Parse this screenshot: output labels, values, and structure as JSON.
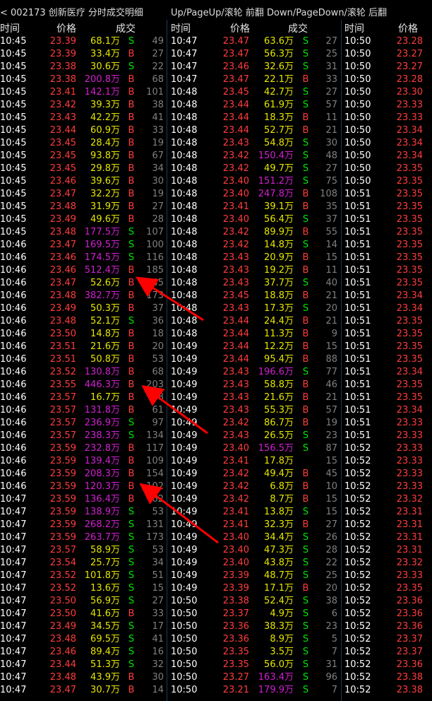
{
  "header": {
    "title": "< 002173 创新医疗   分时成交明细",
    "hint": "Up/PageUp/滚轮 前翻 Down/PageDown/滚轮 后翻"
  },
  "column_headers": {
    "time": "时间",
    "price": "价格",
    "deal": "成交"
  },
  "colors": {
    "up": "#ff3c3c",
    "down": "#00e600",
    "vol_normal": "#e6e600",
    "vol_big": "#d21ed2",
    "neutral": "#808080",
    "arrow": "#ff0000"
  },
  "columns": [
    {
      "rows": [
        [
          "10:45",
          "23.39",
          "68.1万",
          "S",
          "49",
          "r",
          "y"
        ],
        [
          "10:45",
          "23.39",
          "33.4万",
          "B",
          "27",
          "r",
          "y"
        ],
        [
          "10:45",
          "23.38",
          "30.6万",
          "S",
          "22",
          "r",
          "y"
        ],
        [
          "10:45",
          "23.38",
          "200.8万",
          "B",
          "68",
          "r",
          "m"
        ],
        [
          "10:45",
          "23.41",
          "142.1万",
          "B",
          "101",
          "r",
          "m"
        ],
        [
          "10:45",
          "23.42",
          "39.3万",
          "B",
          "38",
          "r",
          "y"
        ],
        [
          "10:45",
          "23.43",
          "42.2万",
          "B",
          "41",
          "r",
          "y"
        ],
        [
          "10:45",
          "23.44",
          "60.9万",
          "B",
          "33",
          "r",
          "y"
        ],
        [
          "10:45",
          "23.45",
          "28.4万",
          "B",
          "19",
          "r",
          "y"
        ],
        [
          "10:45",
          "23.45",
          "93.8万",
          "B",
          "67",
          "r",
          "y"
        ],
        [
          "10:45",
          "23.45",
          "29.8万",
          "B",
          "34",
          "r",
          "y"
        ],
        [
          "10:45",
          "23.46",
          "39.6万",
          "B",
          "30",
          "r",
          "y"
        ],
        [
          "10:45",
          "23.47",
          "32.2万",
          "B",
          "19",
          "r",
          "y"
        ],
        [
          "10:45",
          "23.48",
          "31.9万",
          "B",
          "27",
          "r",
          "y"
        ],
        [
          "10:45",
          "23.49",
          "49.6万",
          "B",
          "28",
          "r",
          "y"
        ],
        [
          "10:45",
          "23.48",
          "177.5万",
          "S",
          "107",
          "r",
          "m"
        ],
        [
          "10:46",
          "23.47",
          "169.5万",
          "S",
          "100",
          "r",
          "m"
        ],
        [
          "10:46",
          "23.46",
          "174.5万",
          "S",
          "116",
          "r",
          "m"
        ],
        [
          "10:46",
          "23.46",
          "512.4万",
          "B",
          "185",
          "r",
          "m"
        ],
        [
          "10:46",
          "23.47",
          "52.6万",
          "B",
          "45",
          "r",
          "y"
        ],
        [
          "10:46",
          "23.48",
          "382.7万",
          "B",
          "173",
          "r",
          "m"
        ],
        [
          "10:46",
          "23.49",
          "50.3万",
          "B",
          "37",
          "r",
          "y"
        ],
        [
          "10:46",
          "23.48",
          "52.1万",
          "S",
          "36",
          "r",
          "y"
        ],
        [
          "10:46",
          "23.50",
          "14.8万",
          "B",
          "18",
          "r",
          "y"
        ],
        [
          "10:46",
          "23.51",
          "21.6万",
          "B",
          "20",
          "r",
          "y"
        ],
        [
          "10:46",
          "23.51",
          "50.8万",
          "B",
          "53",
          "r",
          "y"
        ],
        [
          "10:46",
          "23.52",
          "130.8万",
          "B",
          "68",
          "r",
          "m"
        ],
        [
          "10:46",
          "23.55",
          "446.3万",
          "B",
          "203",
          "r",
          "m"
        ],
        [
          "10:46",
          "23.57",
          "16.7万",
          "B",
          "28",
          "r",
          "y"
        ],
        [
          "10:46",
          "23.57",
          "131.8万",
          "B",
          "61",
          "r",
          "m"
        ],
        [
          "10:46",
          "23.57",
          "236.9万",
          "S",
          "97",
          "r",
          "m"
        ],
        [
          "10:46",
          "23.57",
          "238.3万",
          "S",
          "134",
          "r",
          "m"
        ],
        [
          "10:46",
          "23.59",
          "232.8万",
          "B",
          "117",
          "r",
          "m"
        ],
        [
          "10:46",
          "23.59",
          "139.4万",
          "B",
          "109",
          "r",
          "m"
        ],
        [
          "10:46",
          "23.59",
          "208.3万",
          "B",
          "154",
          "r",
          "m"
        ],
        [
          "10:46",
          "23.59",
          "120.3万",
          "B",
          "102",
          "r",
          "m"
        ],
        [
          "10:47",
          "23.59",
          "136.4万",
          "B",
          "62",
          "r",
          "m"
        ],
        [
          "10:47",
          "23.59",
          "138.9万",
          "S",
          "53",
          "r",
          "m"
        ],
        [
          "10:47",
          "23.59",
          "268.2万",
          "S",
          "131",
          "r",
          "m"
        ],
        [
          "10:47",
          "23.59",
          "263.7万",
          "S",
          "173",
          "r",
          "m"
        ],
        [
          "10:47",
          "23.57",
          "58.9万",
          "S",
          "53",
          "r",
          "y"
        ],
        [
          "10:47",
          "23.54",
          "25.7万",
          "S",
          "34",
          "r",
          "y"
        ],
        [
          "10:47",
          "23.52",
          "101.8万",
          "S",
          "51",
          "r",
          "y"
        ],
        [
          "10:47",
          "23.52",
          "13.6万",
          "S",
          "15",
          "r",
          "y"
        ],
        [
          "10:47",
          "23.50",
          "56.9万",
          "S",
          "27",
          "r",
          "y"
        ],
        [
          "10:47",
          "23.50",
          "41.6万",
          "B",
          "33",
          "r",
          "y"
        ],
        [
          "10:47",
          "23.49",
          "34.5万",
          "S",
          "17",
          "r",
          "y"
        ],
        [
          "10:47",
          "23.48",
          "69.5万",
          "S",
          "41",
          "r",
          "y"
        ],
        [
          "10:47",
          "23.46",
          "89.4万",
          "S",
          "16",
          "r",
          "y"
        ],
        [
          "10:47",
          "23.44",
          "51.3万",
          "S",
          "32",
          "r",
          "y"
        ],
        [
          "10:47",
          "23.48",
          "43.9万",
          "B",
          "30",
          "r",
          "y"
        ],
        [
          "10:47",
          "23.47",
          "30.7万",
          "B",
          "14",
          "r",
          "y"
        ]
      ]
    },
    {
      "rows": [
        [
          "10:47",
          "23.47",
          "63.6万",
          "S",
          "27",
          "r",
          "y"
        ],
        [
          "10:47",
          "23.47",
          "56.3万",
          "S",
          "25",
          "r",
          "y"
        ],
        [
          "10:47",
          "23.46",
          "32.6万",
          "S",
          "31",
          "r",
          "y"
        ],
        [
          "10:47",
          "23.47",
          "22.1万",
          "B",
          "33",
          "r",
          "y"
        ],
        [
          "10:48",
          "23.45",
          "42.7万",
          "S",
          "27",
          "r",
          "y"
        ],
        [
          "10:48",
          "23.44",
          "61.9万",
          "S",
          "57",
          "r",
          "y"
        ],
        [
          "10:48",
          "23.44",
          "18.3万",
          "B",
          "11",
          "r",
          "y"
        ],
        [
          "10:48",
          "23.44",
          "52.7万",
          "B",
          "21",
          "r",
          "y"
        ],
        [
          "10:48",
          "23.43",
          "54.8万",
          "S",
          "30",
          "r",
          "y"
        ],
        [
          "10:48",
          "23.42",
          "150.4万",
          "S",
          "48",
          "r",
          "m"
        ],
        [
          "10:48",
          "23.42",
          "49.7万",
          "S",
          "27",
          "r",
          "y"
        ],
        [
          "10:48",
          "23.40",
          "151.2万",
          "S",
          "75",
          "r",
          "m"
        ],
        [
          "10:48",
          "23.40",
          "247.8万",
          "B",
          "108",
          "r",
          "m"
        ],
        [
          "10:48",
          "23.41",
          "39.1万",
          "B",
          "35",
          "r",
          "y"
        ],
        [
          "10:48",
          "23.40",
          "56.4万",
          "S",
          "37",
          "r",
          "y"
        ],
        [
          "10:48",
          "23.42",
          "89.9万",
          "B",
          "55",
          "r",
          "y"
        ],
        [
          "10:48",
          "23.42",
          "14.8万",
          "S",
          "14",
          "r",
          "y"
        ],
        [
          "10:48",
          "23.43",
          "20.9万",
          "B",
          "15",
          "r",
          "y"
        ],
        [
          "10:48",
          "23.43",
          "19.2万",
          "B",
          "11",
          "r",
          "y"
        ],
        [
          "10:48",
          "23.43",
          "37.7万",
          "S",
          "40",
          "r",
          "y"
        ],
        [
          "10:48",
          "23.45",
          "18.8万",
          "B",
          "21",
          "r",
          "y"
        ],
        [
          "10:48",
          "23.43",
          "17.3万",
          "S",
          "20",
          "r",
          "y"
        ],
        [
          "10:48",
          "23.44",
          "24.4万",
          "B",
          "21",
          "r",
          "y"
        ],
        [
          "10:48",
          "23.44",
          "11.3万",
          "B",
          "9",
          "r",
          "y"
        ],
        [
          "10:49",
          "23.44",
          "12.2万",
          "B",
          "15",
          "r",
          "y"
        ],
        [
          "10:49",
          "23.44",
          "95.4万",
          "B",
          "88",
          "r",
          "y"
        ],
        [
          "10:49",
          "23.43",
          "196.6万",
          "S",
          "77",
          "r",
          "m"
        ],
        [
          "10:49",
          "23.43",
          "58.8万",
          "B",
          "46",
          "r",
          "y"
        ],
        [
          "10:49",
          "23.43",
          "21.6万",
          "B",
          "21",
          "r",
          "y"
        ],
        [
          "10:49",
          "23.43",
          "55.3万",
          "B",
          "57",
          "r",
          "y"
        ],
        [
          "10:49",
          "23.42",
          "86.7万",
          "B",
          "19",
          "r",
          "y"
        ],
        [
          "10:49",
          "23.43",
          "26.5万",
          "S",
          "23",
          "r",
          "y"
        ],
        [
          "10:49",
          "23.40",
          "156.5万",
          "S",
          "87",
          "r",
          "m"
        ],
        [
          "10:49",
          "23.41",
          "17.8万",
          "",
          "15",
          "r",
          "y"
        ],
        [
          "10:49",
          "23.42",
          "49.4万",
          "B",
          "45",
          "r",
          "y"
        ],
        [
          "10:49",
          "23.42",
          "6.8万",
          "B",
          "10",
          "r",
          "y"
        ],
        [
          "10:49",
          "23.42",
          "8.7万",
          "B",
          "15",
          "r",
          "y"
        ],
        [
          "10:49",
          "23.41",
          "13.8万",
          "S",
          "15",
          "r",
          "y"
        ],
        [
          "10:49",
          "23.41",
          "32.3万",
          "B",
          "27",
          "r",
          "y"
        ],
        [
          "10:49",
          "23.40",
          "34.4万",
          "S",
          "26",
          "r",
          "y"
        ],
        [
          "10:49",
          "23.40",
          "47.3万",
          "S",
          "28",
          "r",
          "y"
        ],
        [
          "10:49",
          "23.40",
          "43.8万",
          "S",
          "22",
          "r",
          "y"
        ],
        [
          "10:49",
          "23.39",
          "48.7万",
          "S",
          "25",
          "r",
          "y"
        ],
        [
          "10:49",
          "23.39",
          "17.1万",
          "B",
          "20",
          "r",
          "y"
        ],
        [
          "10:50",
          "23.38",
          "52.4万",
          "S",
          "38",
          "r",
          "y"
        ],
        [
          "10:50",
          "23.37",
          "4.9万",
          "S",
          "6",
          "r",
          "y"
        ],
        [
          "10:50",
          "23.36",
          "38.3万",
          "S",
          "23",
          "r",
          "y"
        ],
        [
          "10:50",
          "23.36",
          "8.9万",
          "S",
          "5",
          "r",
          "y"
        ],
        [
          "10:50",
          "23.35",
          "3.5万",
          "S",
          "7",
          "r",
          "y"
        ],
        [
          "10:50",
          "23.35",
          "56.0万",
          "S",
          "31",
          "r",
          "y"
        ],
        [
          "10:50",
          "23.27",
          "163.4万",
          "S",
          "96",
          "r",
          "m"
        ],
        [
          "10:50",
          "23.21",
          "179.9万",
          "S",
          "7",
          "r",
          "m"
        ]
      ]
    },
    {
      "rows": [
        [
          "10:50",
          "23.28"
        ],
        [
          "10:50",
          "23.27"
        ],
        [
          "10:50",
          "23.27"
        ],
        [
          "10:50",
          "23.28"
        ],
        [
          "10:50",
          "23.30"
        ],
        [
          "10:50",
          "23.33"
        ],
        [
          "10:50",
          "23.33"
        ],
        [
          "10:50",
          "23.34"
        ],
        [
          "10:50",
          "23.34"
        ],
        [
          "10:50",
          "23.34"
        ],
        [
          "10:50",
          "23.35"
        ],
        [
          "10:50",
          "23.35"
        ],
        [
          "10:51",
          "23.35"
        ],
        [
          "10:51",
          "23.35"
        ],
        [
          "10:51",
          "23.35"
        ],
        [
          "10:51",
          "23.35"
        ],
        [
          "10:51",
          "23.35"
        ],
        [
          "10:51",
          "23.35"
        ],
        [
          "10:51",
          "23.35"
        ],
        [
          "10:51",
          "23.35"
        ],
        [
          "10:51",
          "23.34"
        ],
        [
          "10:51",
          "23.34"
        ],
        [
          "10:51",
          "23.35"
        ],
        [
          "10:51",
          "23.35"
        ],
        [
          "10:51",
          "23.35"
        ],
        [
          "10:51",
          "23.35"
        ],
        [
          "10:51",
          "23.34"
        ],
        [
          "10:51",
          "23.35"
        ],
        [
          "10:51",
          "23.35"
        ],
        [
          "10:51",
          "23.34"
        ],
        [
          "10:51",
          "23.33"
        ],
        [
          "10:51",
          "23.33"
        ],
        [
          "10:52",
          "23.33"
        ],
        [
          "10:52",
          "23.33"
        ],
        [
          "10:52",
          "23.33"
        ],
        [
          "10:52",
          "23.33"
        ],
        [
          "10:52",
          "23.32"
        ],
        [
          "10:52",
          "23.31"
        ],
        [
          "10:52",
          "23.31"
        ],
        [
          "10:52",
          "23.31"
        ],
        [
          "10:52",
          "23.31"
        ],
        [
          "10:52",
          "23.32"
        ],
        [
          "10:52",
          "23.33"
        ],
        [
          "10:52",
          "23.35"
        ],
        [
          "10:52",
          "23.36"
        ],
        [
          "10:52",
          "23.36"
        ],
        [
          "10:52",
          "23.36"
        ],
        [
          "10:52",
          "23.37"
        ],
        [
          "10:52",
          "23.37"
        ],
        [
          "10:52",
          "23.36"
        ],
        [
          "10:52",
          "23.38"
        ],
        [
          "10:52",
          "23.38"
        ]
      ]
    }
  ]
}
